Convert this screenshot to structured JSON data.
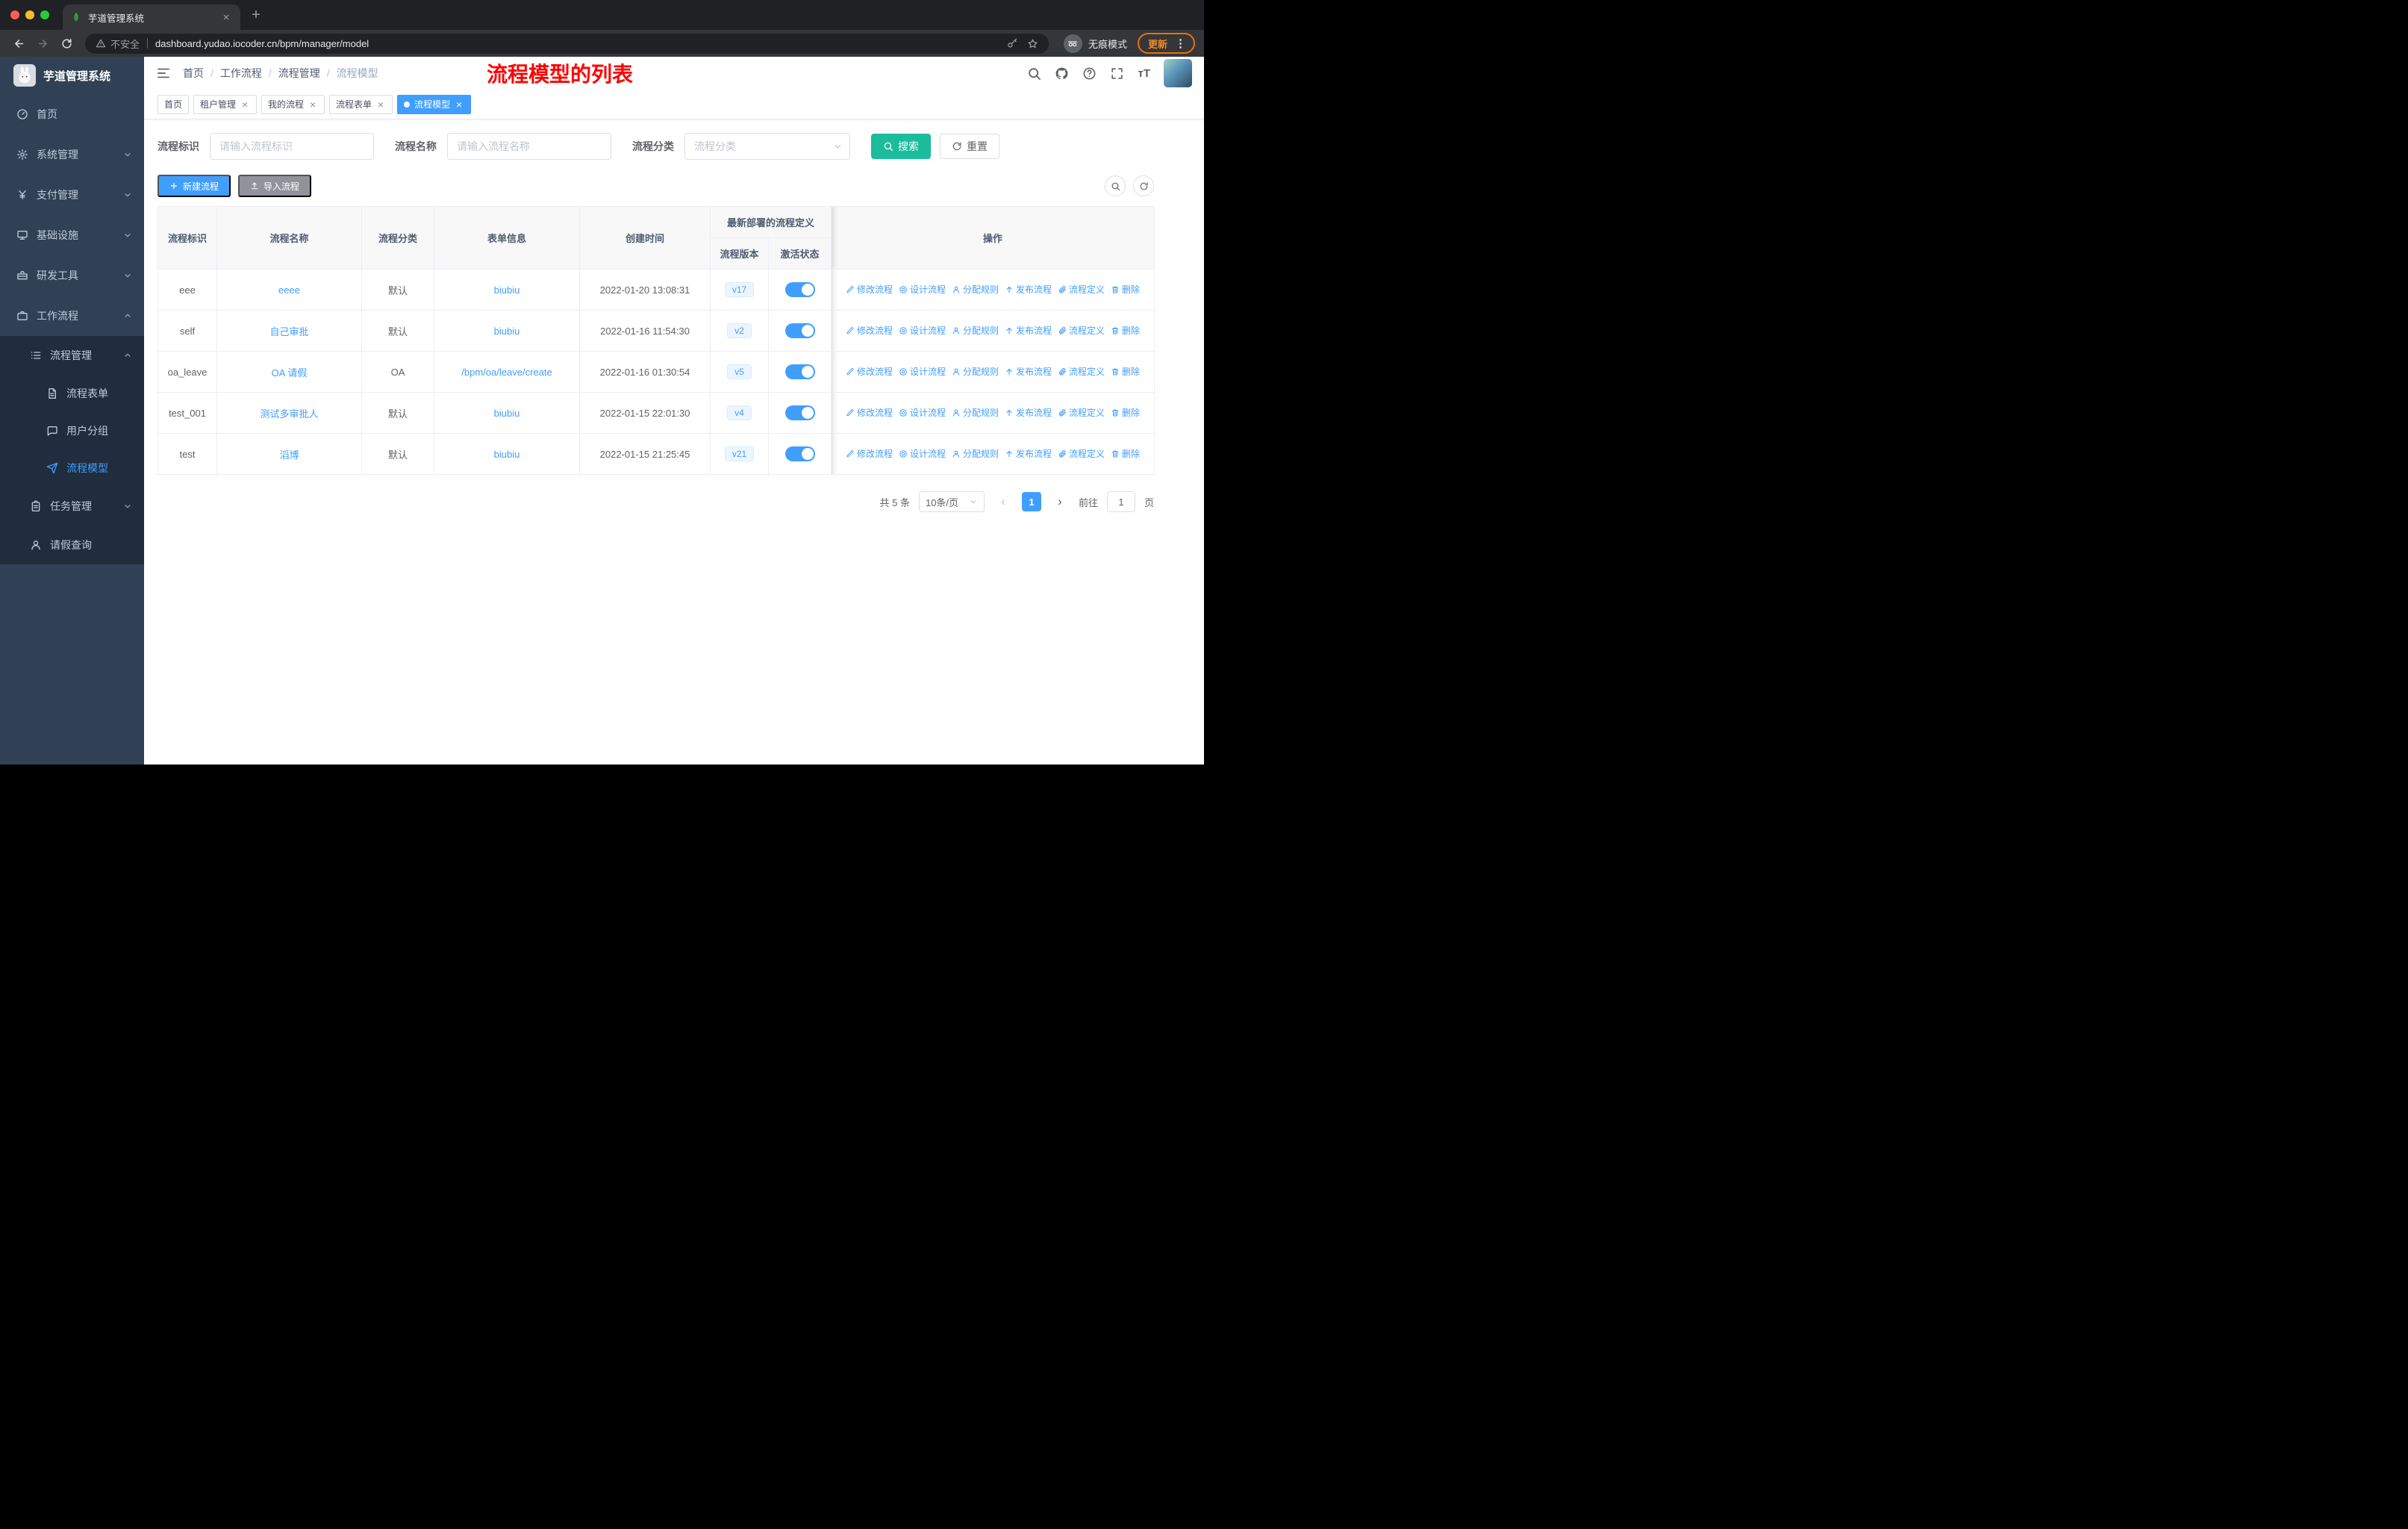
{
  "browser": {
    "tab_title": "芋道管理系统",
    "security_label": "不安全",
    "url": "dashboard.yudao.iocoder.cn/bpm/manager/model",
    "incognito_label": "无痕模式",
    "update_label": "更新"
  },
  "icons": {
    "close": "×",
    "new_tab": "+",
    "menu_dots": "⋮",
    "prev": "‹",
    "next": "›",
    "font_size": "тT"
  },
  "sidebar": {
    "logo": "芋道管理系统",
    "home": "首页",
    "system": "系统管理",
    "payment": "支付管理",
    "infrastructure": "基础设施",
    "dev_tools": "研发工具",
    "workflow": "工作流程",
    "process_management": "流程管理",
    "process_form": "流程表单",
    "user_group": "用户分组",
    "process_model": "流程模型",
    "task_management": "任务管理",
    "leave_query": "请假查询"
  },
  "header": {
    "breadcrumb": [
      "首页",
      "工作流程",
      "流程管理",
      "流程模型"
    ],
    "annotation": "流程模型的列表"
  },
  "tags": {
    "home": "首页",
    "tenant": "租户管理",
    "my_process": "我的流程",
    "process_form": "流程表单",
    "process_model": "流程模型"
  },
  "filters": {
    "id_label": "流程标识",
    "id_placeholder": "请输入流程标识",
    "name_label": "流程名称",
    "name_placeholder": "请输入流程名称",
    "category_label": "流程分类",
    "category_placeholder": "流程分类",
    "search_label": "搜索",
    "reset_label": "重置"
  },
  "toolbar": {
    "create_label": "新建流程",
    "import_label": "导入流程"
  },
  "table": {
    "headers": {
      "id": "流程标识",
      "name": "流程名称",
      "category": "流程分类",
      "form": "表单信息",
      "created": "创建时间",
      "group": "最新部署的流程定义",
      "version": "流程版本",
      "status": "激活状态",
      "ops": "操作"
    },
    "actions": [
      "修改流程",
      "设计流程",
      "分配规则",
      "发布流程",
      "流程定义",
      "删除"
    ],
    "rows": [
      {
        "id": "eee",
        "name": "eeee",
        "category": "默认",
        "form": "biubiu",
        "created": "2022-01-20 13:08:31",
        "version": "v17",
        "active": true
      },
      {
        "id": "self",
        "name": "自己审批",
        "category": "默认",
        "form": "biubiu",
        "created": "2022-01-16 11:54:30",
        "version": "v2",
        "active": true
      },
      {
        "id": "oa_leave",
        "name": "OA 请假",
        "category": "OA",
        "form": "/bpm/oa/leave/create",
        "created": "2022-01-16 01:30:54",
        "version": "v5",
        "active": true
      },
      {
        "id": "test_001",
        "name": "测试多审批人",
        "category": "默认",
        "form": "biubiu",
        "created": "2022-01-15 22:01:30",
        "version": "v4",
        "active": true
      },
      {
        "id": "test",
        "name": "滔博",
        "category": "默认",
        "form": "biubiu",
        "created": "2022-01-15 21:25:45",
        "version": "v21",
        "active": true
      }
    ]
  },
  "pagination": {
    "total": "共 5 条",
    "page_size": "10条/页",
    "current_page": "1",
    "goto_label": "前往",
    "goto_value": "1",
    "page_unit": "页"
  },
  "colors": {
    "primary": "#409eff",
    "search_button": "#1abc9c",
    "annotation_red": "#ff0000",
    "sidebar_bg": "#304156",
    "submenu_bg": "#1f2d3d"
  }
}
